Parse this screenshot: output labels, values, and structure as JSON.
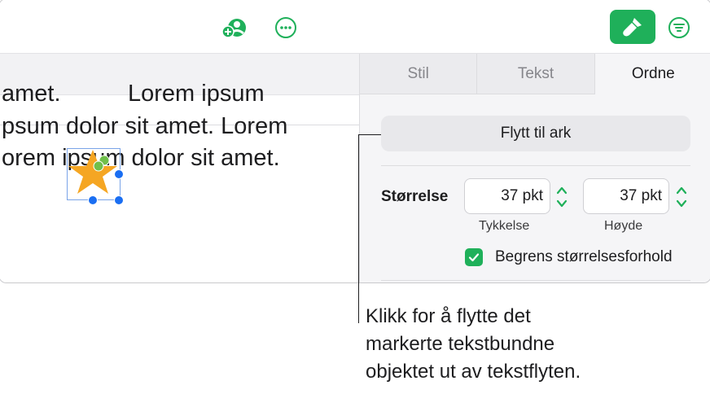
{
  "document": {
    "lines": [
      "amet.",
      "Lorem ipsum",
      "psum dolor sit amet. Lorem",
      "orem ipsum dolor sit amet."
    ]
  },
  "inspector": {
    "tabs": [
      "Stil",
      "Tekst",
      "Ordne"
    ],
    "active_tab": "Ordne",
    "move_button": "Flytt til ark",
    "size_label": "Størrelse",
    "width_value": "37 pkt",
    "height_value": "37 pkt",
    "width_label": "Tykkelse",
    "height_label": "Høyde",
    "constrain_label": "Begrens størrelsesforhold",
    "constrain_checked": true
  },
  "callout": {
    "lines": [
      "Klikk for å flytte det",
      "markerte tekstbundne",
      "objektet ut av tekstflyten."
    ]
  },
  "colors": {
    "accent": "#1fb05a",
    "selection": "#1a6ef2",
    "star": "#f5a623"
  },
  "icons": {
    "collaborate": "person-add-icon",
    "more": "ellipsis-circle-icon",
    "format": "paintbrush-icon",
    "organize": "list-filter-icon"
  }
}
